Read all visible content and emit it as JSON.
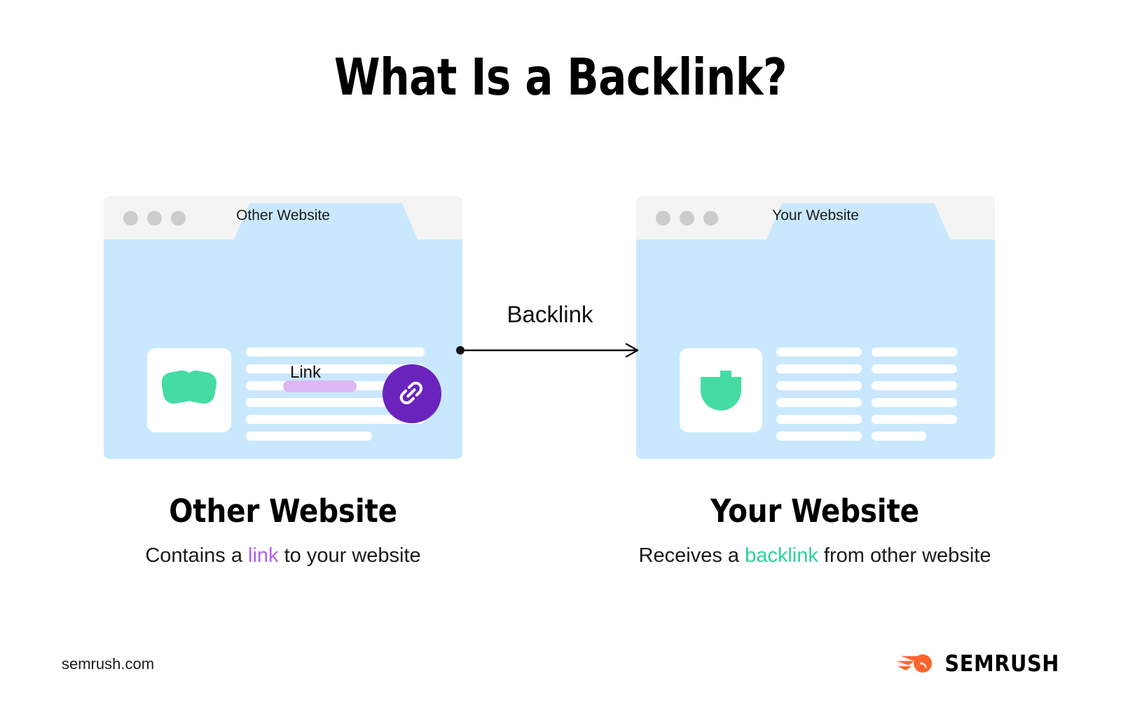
{
  "title": "What Is a Backlink?",
  "colors": {
    "background": "#ffffff",
    "browser_body_blue": "#c9e8fd",
    "browser_chrome_gray": "#f4f4f4",
    "dot_gray": "#cccccc",
    "purple_circle": "#6a23bd",
    "link_highlight": "#ddb8f5",
    "link_word": "#b35ef0",
    "backlink_word": "#2bd39b",
    "logo_green": "#45dca4",
    "brand_orange": "#ff642d",
    "text_black": "#000000"
  },
  "left_window": {
    "tab_label": "Other Website",
    "dots_count": 3,
    "logo_icon": "semrush-blob-icon",
    "link_label": "Link",
    "text_lines": [
      {
        "width": "full"
      },
      {
        "width": "full"
      },
      {
        "width": "full"
      },
      {
        "width": "full"
      },
      {
        "width": "full"
      },
      {
        "width": "short"
      }
    ],
    "badge_icon": "chain-link-icon"
  },
  "right_window": {
    "tab_label": "Your Website",
    "dots_count": 3,
    "logo_icon": "semrush-shield-icon",
    "column_one_lines": [
      {
        "width": "full"
      },
      {
        "width": "full"
      },
      {
        "width": "full"
      },
      {
        "width": "full"
      },
      {
        "width": "full"
      },
      {
        "width": "full"
      }
    ],
    "column_two_lines": [
      {
        "width": "full"
      },
      {
        "width": "full"
      },
      {
        "width": "full"
      },
      {
        "width": "full"
      },
      {
        "width": "full"
      },
      {
        "width": "short"
      }
    ]
  },
  "connector": {
    "label": "Backlink",
    "direction": "left-to-right",
    "start_marker": "dot",
    "end_marker": "arrowhead"
  },
  "captions": {
    "left": {
      "heading": "Other Website",
      "sub_prefix": "Contains a ",
      "sub_highlight": "link",
      "sub_suffix": " to your website"
    },
    "right": {
      "heading": "Your Website",
      "sub_prefix": "Receives a ",
      "sub_highlight": "backlink",
      "sub_suffix": " from other website"
    }
  },
  "footer": {
    "url": "semrush.com",
    "brand_name": "SEMRUSH",
    "brand_icon": "semrush-comet-icon"
  }
}
